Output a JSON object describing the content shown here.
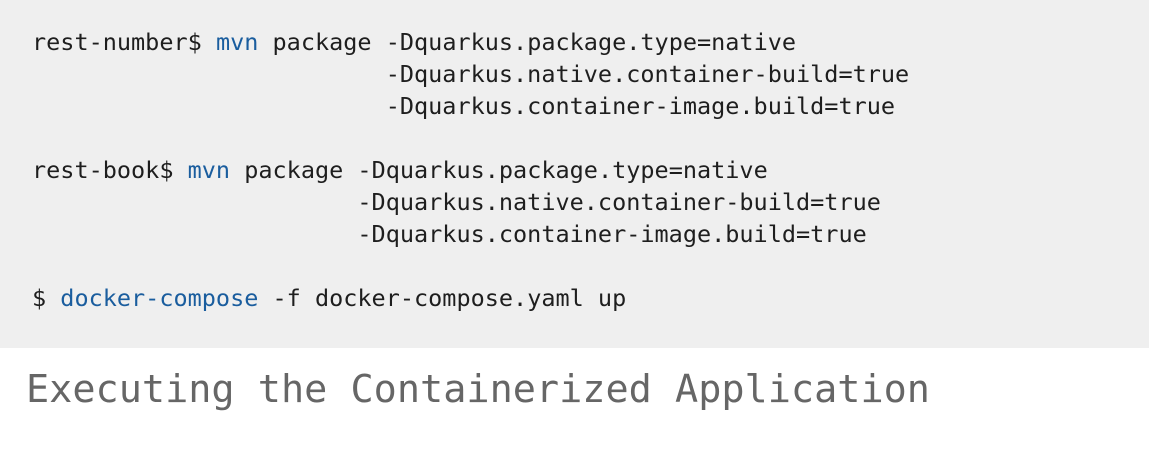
{
  "code": {
    "block1": {
      "prompt": "rest-number$ ",
      "command": "mvn",
      "args_line1": " package -Dquarkus.package.type=native",
      "line2": "                         -Dquarkus.native.container-build=true",
      "line3": "                         -Dquarkus.container-image.build=true"
    },
    "block2": {
      "prompt": "rest-book$ ",
      "command": "mvn",
      "args_line1": " package -Dquarkus.package.type=native",
      "line2": "                       -Dquarkus.native.container-build=true",
      "line3": "                       -Dquarkus.container-image.build=true"
    },
    "block3": {
      "prompt": "$ ",
      "command": "docker-compose",
      "args_line1": " -f docker-compose.yaml up"
    }
  },
  "caption": "Executing the Containerized Application",
  "colors": {
    "code_background": "#efefef",
    "command_highlight": "#1a5d9e",
    "caption_text": "#666666"
  }
}
